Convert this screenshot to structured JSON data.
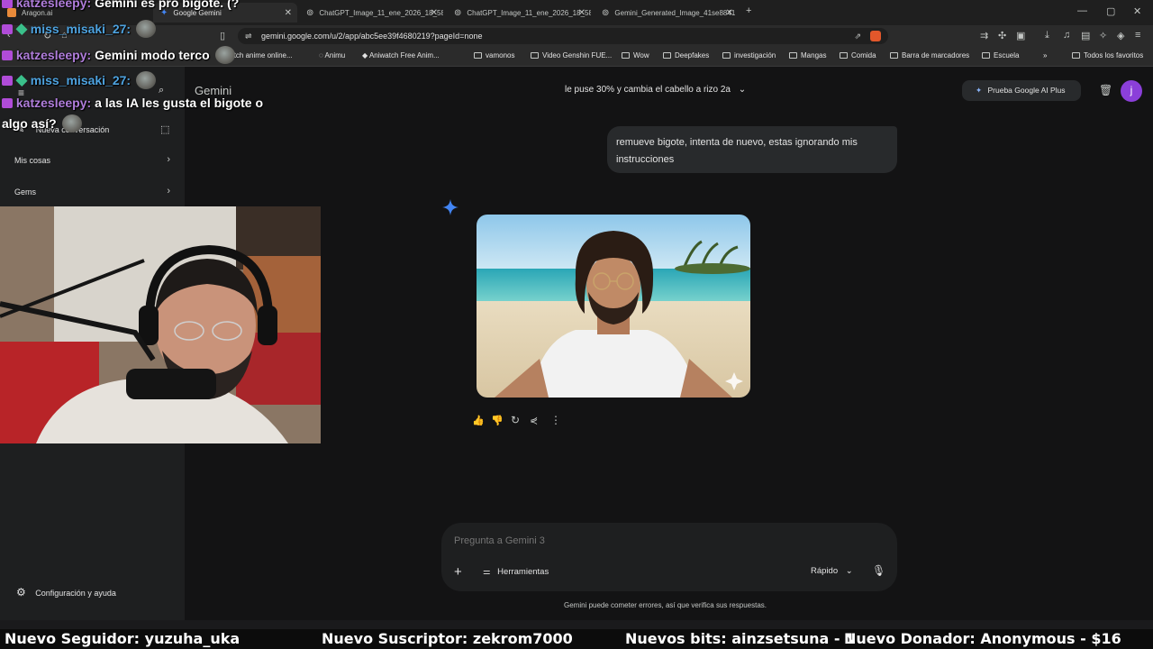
{
  "tabs": [
    {
      "label": "Aragon.ai",
      "active": false
    },
    {
      "label": "Google Gemini",
      "active": true
    },
    {
      "label": "ChatGPT_Image_11_ene_2026_18_58",
      "active": false
    },
    {
      "label": "ChatGPT_Image_11_ene_2026_18_58",
      "active": false
    },
    {
      "label": "Gemini_Generated_Image_41se8841",
      "active": false
    }
  ],
  "address": {
    "url": "gemini.google.com/u/2/app/abc5ee39f4680219?pageId=none"
  },
  "bookmarks": [
    {
      "label": "Watch anime online..."
    },
    {
      "label": "Animu"
    },
    {
      "label": "Aniwatch Free Anim..."
    },
    {
      "label": "vamonos"
    },
    {
      "label": "Video Genshin FUE..."
    },
    {
      "label": "Wow"
    },
    {
      "label": "Deepfakes"
    },
    {
      "label": "investigación"
    },
    {
      "label": "Mangas"
    },
    {
      "label": "Comida"
    },
    {
      "label": "Barra de marcadores"
    },
    {
      "label": "Escuela"
    },
    {
      "label": "Todos los favoritos"
    }
  ],
  "sidebar": {
    "app_title": "Gemini",
    "new_chat": "Nueva conversación",
    "my_stuff": "Mis cosas",
    "gems": "Gems",
    "settings": "Configuración y ayuda"
  },
  "header": {
    "chat_title": "le puse 30% y cambia el cabello a rizo 2a",
    "upgrade_button": "Prueba Google AI Plus",
    "avatar_letter": "j"
  },
  "conversation": {
    "user_message": "remueve bigote, intenta de nuevo, estas ignorando mis instrucciones"
  },
  "input": {
    "placeholder": "Pregunta a Gemini 3",
    "tools_label": "Herramientas",
    "mode_label": "Rápido",
    "disclaimer": "Gemini puede cometer errores, así que verifica sus respuestas."
  },
  "chat_overlay": [
    {
      "user": "katzesleepy:",
      "message": "Gemini es pro bigote. (?"
    },
    {
      "user": "miss_misaki_27:",
      "message": ""
    },
    {
      "user": "katzesleepy:",
      "message": "Gemini modo terco"
    },
    {
      "user": "miss_misaki_27:",
      "message": ""
    },
    {
      "user": "katzesleepy:",
      "message": "a las IA les gusta el bigote o"
    },
    {
      "user": "",
      "message": "algo así?"
    }
  ],
  "alerts": {
    "follower": "Nuevo Seguidor: yuzuha_uka",
    "subscriber": "Nuevo Suscriptor: zekrom7000",
    "bits": "Nuevos bits: ainzsetsuna - 1",
    "donor": "Nuevo Donador: Anonymous - $16"
  },
  "colors": {
    "accent_purple": "#8b3fd9",
    "gemini_blue": "#4285f4",
    "background": "#131314"
  }
}
